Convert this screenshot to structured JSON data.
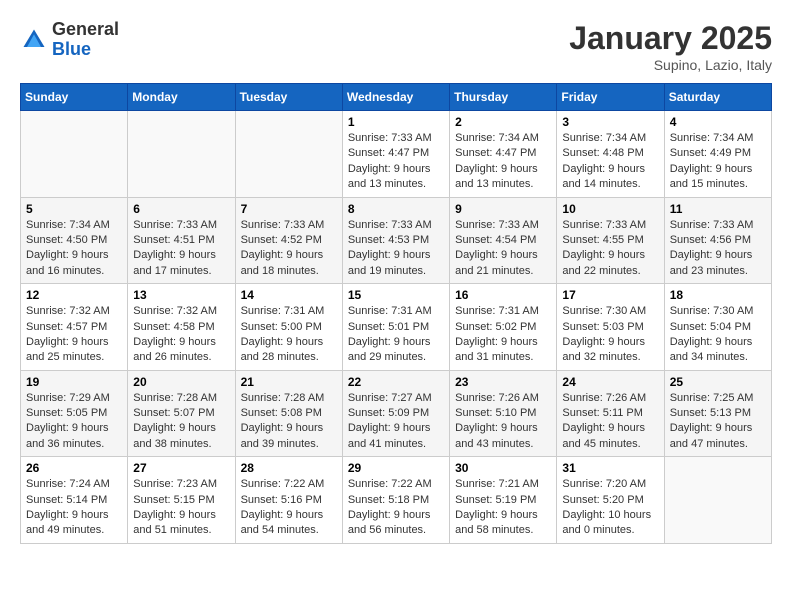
{
  "header": {
    "logo_general": "General",
    "logo_blue": "Blue",
    "month": "January 2025",
    "location": "Supino, Lazio, Italy"
  },
  "weekdays": [
    "Sunday",
    "Monday",
    "Tuesday",
    "Wednesday",
    "Thursday",
    "Friday",
    "Saturday"
  ],
  "weeks": [
    [
      {
        "day": "",
        "info": ""
      },
      {
        "day": "",
        "info": ""
      },
      {
        "day": "",
        "info": ""
      },
      {
        "day": "1",
        "sunrise": "7:33 AM",
        "sunset": "4:47 PM",
        "daylight": "9 hours and 13 minutes."
      },
      {
        "day": "2",
        "sunrise": "7:34 AM",
        "sunset": "4:47 PM",
        "daylight": "9 hours and 13 minutes."
      },
      {
        "day": "3",
        "sunrise": "7:34 AM",
        "sunset": "4:48 PM",
        "daylight": "9 hours and 14 minutes."
      },
      {
        "day": "4",
        "sunrise": "7:34 AM",
        "sunset": "4:49 PM",
        "daylight": "9 hours and 15 minutes."
      }
    ],
    [
      {
        "day": "5",
        "sunrise": "7:34 AM",
        "sunset": "4:50 PM",
        "daylight": "9 hours and 16 minutes."
      },
      {
        "day": "6",
        "sunrise": "7:33 AM",
        "sunset": "4:51 PM",
        "daylight": "9 hours and 17 minutes."
      },
      {
        "day": "7",
        "sunrise": "7:33 AM",
        "sunset": "4:52 PM",
        "daylight": "9 hours and 18 minutes."
      },
      {
        "day": "8",
        "sunrise": "7:33 AM",
        "sunset": "4:53 PM",
        "daylight": "9 hours and 19 minutes."
      },
      {
        "day": "9",
        "sunrise": "7:33 AM",
        "sunset": "4:54 PM",
        "daylight": "9 hours and 21 minutes."
      },
      {
        "day": "10",
        "sunrise": "7:33 AM",
        "sunset": "4:55 PM",
        "daylight": "9 hours and 22 minutes."
      },
      {
        "day": "11",
        "sunrise": "7:33 AM",
        "sunset": "4:56 PM",
        "daylight": "9 hours and 23 minutes."
      }
    ],
    [
      {
        "day": "12",
        "sunrise": "7:32 AM",
        "sunset": "4:57 PM",
        "daylight": "9 hours and 25 minutes."
      },
      {
        "day": "13",
        "sunrise": "7:32 AM",
        "sunset": "4:58 PM",
        "daylight": "9 hours and 26 minutes."
      },
      {
        "day": "14",
        "sunrise": "7:31 AM",
        "sunset": "5:00 PM",
        "daylight": "9 hours and 28 minutes."
      },
      {
        "day": "15",
        "sunrise": "7:31 AM",
        "sunset": "5:01 PM",
        "daylight": "9 hours and 29 minutes."
      },
      {
        "day": "16",
        "sunrise": "7:31 AM",
        "sunset": "5:02 PM",
        "daylight": "9 hours and 31 minutes."
      },
      {
        "day": "17",
        "sunrise": "7:30 AM",
        "sunset": "5:03 PM",
        "daylight": "9 hours and 32 minutes."
      },
      {
        "day": "18",
        "sunrise": "7:30 AM",
        "sunset": "5:04 PM",
        "daylight": "9 hours and 34 minutes."
      }
    ],
    [
      {
        "day": "19",
        "sunrise": "7:29 AM",
        "sunset": "5:05 PM",
        "daylight": "9 hours and 36 minutes."
      },
      {
        "day": "20",
        "sunrise": "7:28 AM",
        "sunset": "5:07 PM",
        "daylight": "9 hours and 38 minutes."
      },
      {
        "day": "21",
        "sunrise": "7:28 AM",
        "sunset": "5:08 PM",
        "daylight": "9 hours and 39 minutes."
      },
      {
        "day": "22",
        "sunrise": "7:27 AM",
        "sunset": "5:09 PM",
        "daylight": "9 hours and 41 minutes."
      },
      {
        "day": "23",
        "sunrise": "7:26 AM",
        "sunset": "5:10 PM",
        "daylight": "9 hours and 43 minutes."
      },
      {
        "day": "24",
        "sunrise": "7:26 AM",
        "sunset": "5:11 PM",
        "daylight": "9 hours and 45 minutes."
      },
      {
        "day": "25",
        "sunrise": "7:25 AM",
        "sunset": "5:13 PM",
        "daylight": "9 hours and 47 minutes."
      }
    ],
    [
      {
        "day": "26",
        "sunrise": "7:24 AM",
        "sunset": "5:14 PM",
        "daylight": "9 hours and 49 minutes."
      },
      {
        "day": "27",
        "sunrise": "7:23 AM",
        "sunset": "5:15 PM",
        "daylight": "9 hours and 51 minutes."
      },
      {
        "day": "28",
        "sunrise": "7:22 AM",
        "sunset": "5:16 PM",
        "daylight": "9 hours and 54 minutes."
      },
      {
        "day": "29",
        "sunrise": "7:22 AM",
        "sunset": "5:18 PM",
        "daylight": "9 hours and 56 minutes."
      },
      {
        "day": "30",
        "sunrise": "7:21 AM",
        "sunset": "5:19 PM",
        "daylight": "9 hours and 58 minutes."
      },
      {
        "day": "31",
        "sunrise": "7:20 AM",
        "sunset": "5:20 PM",
        "daylight": "10 hours and 0 minutes."
      },
      {
        "day": "",
        "info": ""
      }
    ]
  ]
}
